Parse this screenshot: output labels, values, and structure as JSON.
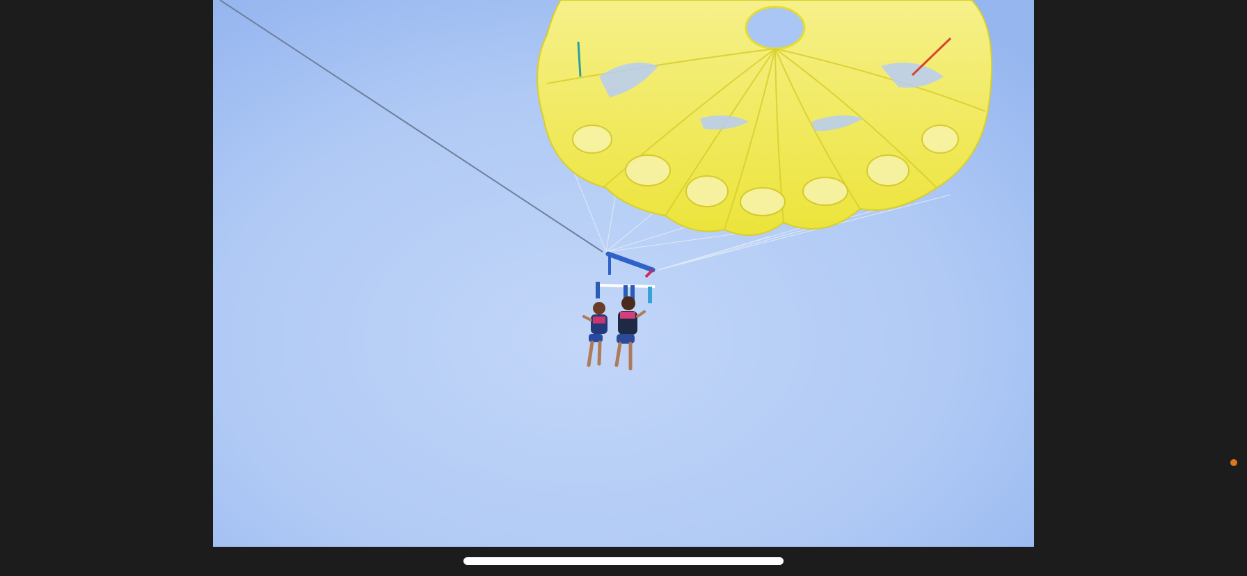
{
  "viewer": {
    "background": "#1c1c1c",
    "photo": {
      "subject": "parasailing",
      "sky_color": "#aac6f4",
      "canopy_color": "#f2ec3a"
    },
    "home_indicator": {
      "color": "#ffffff"
    },
    "indicator_dot": {
      "icon": "orange-dot-icon",
      "color": "#d9781e"
    }
  }
}
